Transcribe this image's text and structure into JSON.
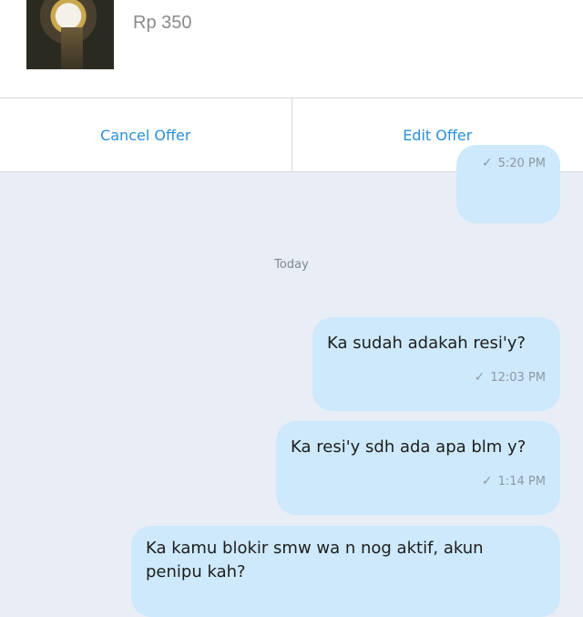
{
  "product": {
    "price": "Rp 350"
  },
  "actions": {
    "cancel": "Cancel Offer",
    "edit": "Edit Offer"
  },
  "chat": {
    "day_divider": "Today",
    "messages": [
      {
        "text": "",
        "time": "5:20 PM"
      },
      {
        "text": "Ka sudah adakah resi'y?",
        "time": "12:03 PM"
      },
      {
        "text": "Ka resi'y sdh ada apa blm y?",
        "time": "1:14 PM"
      },
      {
        "text": "Ka kamu blokir smw wa n nog aktif, akun\npenipu kah?",
        "time": ""
      }
    ]
  },
  "colors": {
    "accent": "#2a8fd8",
    "bubble": "#cde9fb",
    "background": "#e9edf5"
  }
}
